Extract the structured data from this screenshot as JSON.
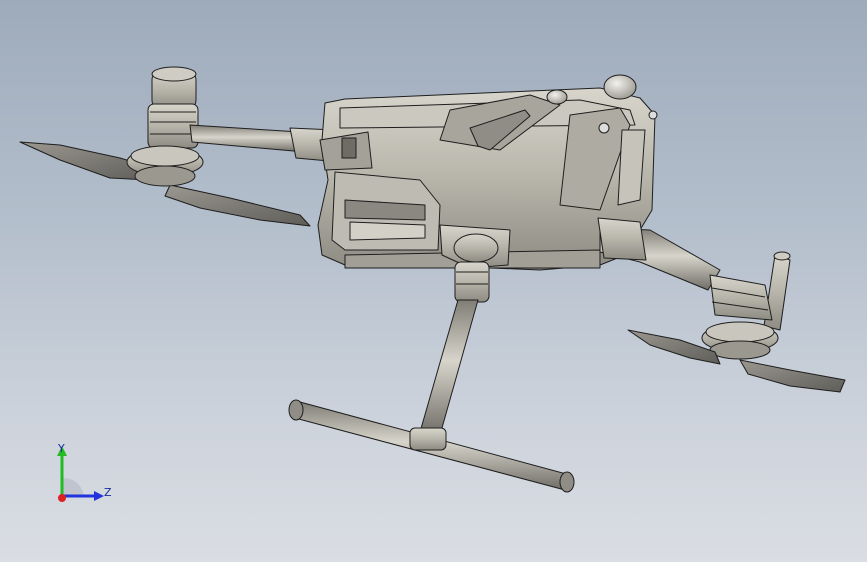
{
  "viewport": {
    "background_top": "#9eabbb",
    "background_bottom": "#dadde3"
  },
  "model": {
    "subject": "quadcopter-drone-assembly",
    "render_style": "shaded-with-edges",
    "body_color": "#b8b6ab",
    "edge_color": "#1e1e1e"
  },
  "triad": {
    "y_label": "Y",
    "z_label": "Z",
    "y_color": "#22bb22",
    "z_color": "#2233dd",
    "x_color": "#dd2222"
  }
}
